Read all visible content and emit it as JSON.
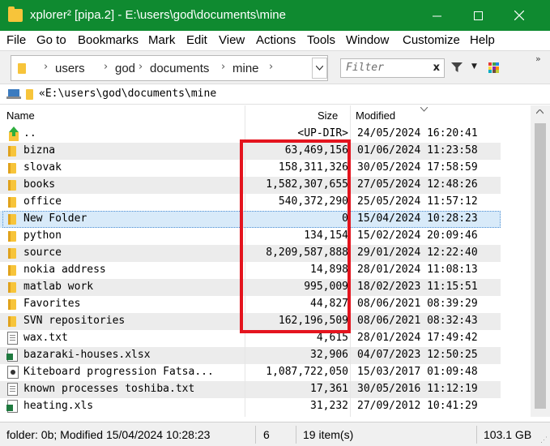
{
  "window": {
    "title": "xplorer² [pipa.2] - E:\\users\\god\\documents\\mine",
    "minimize_icon": "minimize-icon",
    "maximize_icon": "maximize-icon",
    "close_icon": "close-icon",
    "titlebar_color": "#0f8a30"
  },
  "menu": {
    "items": [
      "File",
      "Go to",
      "Bookmarks",
      "Mark",
      "Edit",
      "View",
      "Actions",
      "Tools",
      "Window",
      "Customize",
      "Help"
    ]
  },
  "address": {
    "crumbs": [
      "users",
      "god",
      "documents",
      "mine"
    ]
  },
  "filter": {
    "placeholder": "Filter",
    "clear": "x"
  },
  "path": {
    "text": "«E:\\users\\god\\documents\\mine"
  },
  "columns": {
    "name": "Name",
    "size": "Size",
    "modified": "Modified"
  },
  "files": [
    {
      "name": "..",
      "size": "<UP-DIR>",
      "modified": "24/05/2024 16:20:41",
      "icon": "up-dir-icon"
    },
    {
      "name": "bizna",
      "size": "63,469,156",
      "modified": "01/06/2024 11:23:58",
      "icon": "folder-icon"
    },
    {
      "name": "slovak",
      "size": "158,311,326",
      "modified": "30/05/2024 17:58:59",
      "icon": "folder-icon"
    },
    {
      "name": "books",
      "size": "1,582,307,655",
      "modified": "27/05/2024 12:48:26",
      "icon": "folder-icon"
    },
    {
      "name": "office",
      "size": "540,372,290",
      "modified": "25/05/2024 11:57:12",
      "icon": "folder-icon"
    },
    {
      "name": "New Folder",
      "size": "0",
      "modified": "15/04/2024 10:28:23",
      "icon": "folder-icon",
      "selected": true
    },
    {
      "name": "python",
      "size": "134,154",
      "modified": "15/02/2024 20:09:46",
      "icon": "folder-icon"
    },
    {
      "name": "source",
      "size": "8,209,587,888",
      "modified": "29/01/2024 12:22:40",
      "icon": "folder-icon"
    },
    {
      "name": "nokia address",
      "size": "14,898",
      "modified": "28/01/2024 11:08:13",
      "icon": "folder-icon"
    },
    {
      "name": "matlab work",
      "size": "995,009",
      "modified": "18/02/2023 11:15:51",
      "icon": "folder-icon"
    },
    {
      "name": "Favorites",
      "size": "44,827",
      "modified": "08/06/2021 08:39:29",
      "icon": "folder-icon"
    },
    {
      "name": "SVN repositories",
      "size": "162,196,509",
      "modified": "08/06/2021 08:32:43",
      "icon": "folder-icon"
    },
    {
      "name": "wax.txt",
      "size": "4,615",
      "modified": "28/01/2024 17:49:42",
      "icon": "text-file-icon"
    },
    {
      "name": "bazaraki-houses.xlsx",
      "size": "32,906",
      "modified": "04/07/2023 12:50:25",
      "icon": "excel-file-icon"
    },
    {
      "name": "Kiteboard progression Fatsa...",
      "size": "1,087,722,050",
      "modified": "15/03/2017 01:09:48",
      "icon": "media-file-icon"
    },
    {
      "name": "known processes toshiba.txt",
      "size": "17,361",
      "modified": "30/05/2016 11:12:19",
      "icon": "text-file-icon"
    },
    {
      "name": "heating.xls",
      "size": "31,232",
      "modified": "27/09/2012 10:41:29",
      "icon": "excel-file-icon"
    }
  ],
  "status": {
    "info": "folder: 0b; Modified 15/04/2024 10:28:23",
    "selected_count": "6",
    "items": "19 item(s)",
    "free": "103.1 GB"
  },
  "colors": {
    "highlight": "#e4141e",
    "folder": "#f7c43a",
    "selection": "#d8eaf9"
  }
}
